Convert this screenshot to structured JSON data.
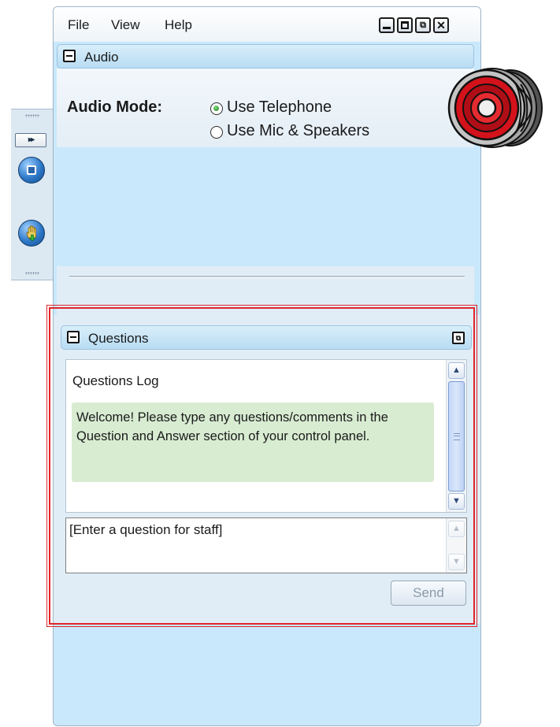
{
  "menu": {
    "file": "File",
    "view": "View",
    "help": "Help"
  },
  "window_controls": {
    "minimize": "minimize-icon",
    "maximize": "maximize-icon",
    "popout": "popout-icon",
    "close": "close-icon"
  },
  "audio": {
    "title": "Audio",
    "mode_label": "Audio Mode:",
    "options": [
      {
        "label": "Use Telephone",
        "selected": true
      },
      {
        "label": "Use Mic & Speakers",
        "selected": false
      }
    ]
  },
  "questions": {
    "title": "Questions",
    "log_title": "Questions Log",
    "welcome_message": "Welcome! Please type any questions/comments in the Question and Answer section of your control panel.",
    "input_placeholder": "[Enter a question for staff]",
    "send_label": "Send"
  },
  "toolbar": {
    "expand_glyph": "▸▸"
  },
  "colors": {
    "panel_bg": "#c9e8fb",
    "highlight": "#e2242b",
    "speaker_red": "#d3121b",
    "message_bg": "#d8ecd2"
  }
}
